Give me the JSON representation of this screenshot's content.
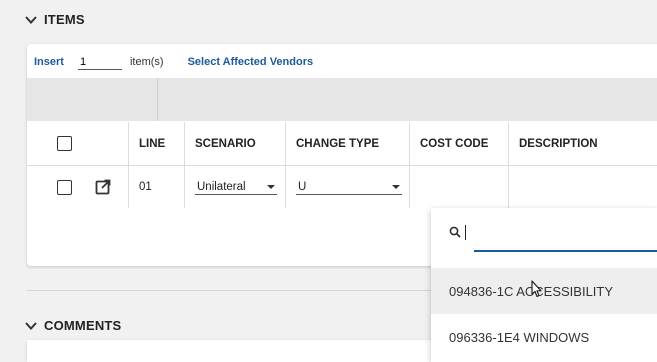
{
  "sections": {
    "items_title": "ITEMS",
    "comments_title": "COMMENTS"
  },
  "toolbar": {
    "insert_label": "Insert",
    "quantity_value": "1",
    "items_suffix": "item(s)",
    "select_vendors_label": "Select Affected Vendors"
  },
  "table": {
    "columns": [
      "LINE",
      "SCENARIO",
      "CHANGE TYPE",
      "COST CODE",
      "DESCRIPTION"
    ],
    "row": {
      "line": "01",
      "scenario": "Unilateral",
      "change_type": "U"
    }
  },
  "dropdown": {
    "search_value": "",
    "options": [
      "094836-1C ACCESSIBILITY",
      "096336-1E4 WINDOWS"
    ]
  },
  "icons": {
    "section_toggle": "chevron-down-icon",
    "edit": "open-in-new-icon",
    "search": "search-icon",
    "cursor": "mouse-pointer-icon"
  }
}
